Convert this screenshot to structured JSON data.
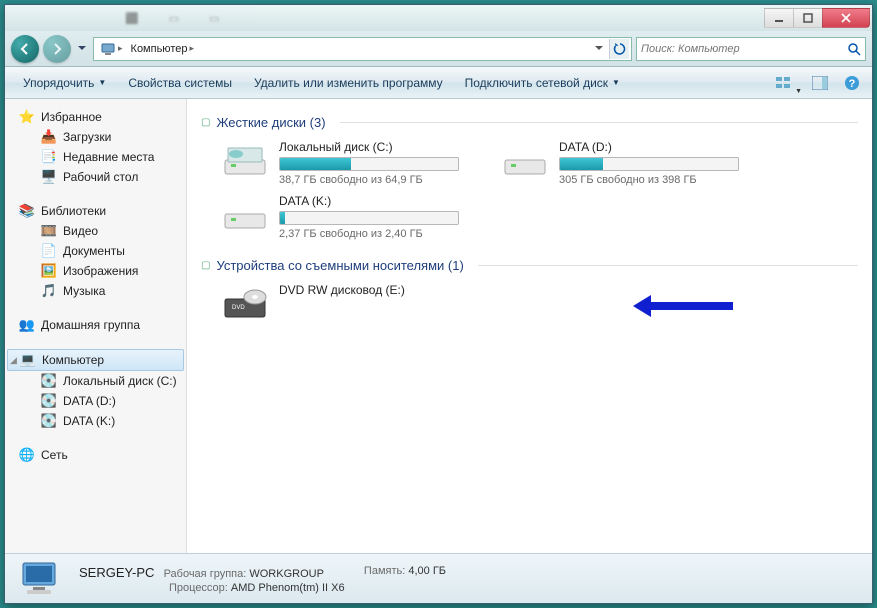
{
  "window": {
    "minimize_tip": "Свернуть",
    "maximize_tip": "Развернуть",
    "close_tip": "Закрыть"
  },
  "address_bar": {
    "root": "Компьютер",
    "search_placeholder": "Поиск: Компьютер"
  },
  "toolbar": {
    "organize": "Упорядочить",
    "properties": "Свойства системы",
    "uninstall": "Удалить или изменить программу",
    "map_drive": "Подключить сетевой диск"
  },
  "sidebar": {
    "favorites": {
      "header": "Избранное",
      "items": [
        "Загрузки",
        "Недавние места",
        "Рабочий стол"
      ]
    },
    "libraries": {
      "header": "Библиотеки",
      "items": [
        "Видео",
        "Документы",
        "Изображения",
        "Музыка"
      ]
    },
    "homegroup": {
      "header": "Домашняя группа"
    },
    "computer": {
      "header": "Компьютер",
      "items": [
        "Локальный диск (C:)",
        "DATA (D:)",
        "DATA (K:)"
      ]
    },
    "network": {
      "header": "Сеть"
    }
  },
  "sections": {
    "hard_drives": "Жесткие диски (3)",
    "removable": "Устройства со съемными носителями (1)"
  },
  "drives": [
    {
      "name": "Локальный диск (C:)",
      "free_text": "38,7 ГБ свободно из 64,9 ГБ",
      "fill_percent": 40
    },
    {
      "name": "DATA (D:)",
      "free_text": "305 ГБ свободно из 398 ГБ",
      "fill_percent": 24
    },
    {
      "name": "DATA (K:)",
      "free_text": "2,37 ГБ свободно из 2,40 ГБ",
      "fill_percent": 3
    }
  ],
  "removable_drives": [
    {
      "name": "DVD RW дисковод (E:)"
    }
  ],
  "status": {
    "pc_name": "SERGEY-PC",
    "workgroup_label": "Рабочая группа:",
    "workgroup": "WORKGROUP",
    "memory_label": "Память:",
    "memory": "4,00 ГБ",
    "cpu_label": "Процессор:",
    "cpu": "AMD Phenom(tm) II X6"
  }
}
